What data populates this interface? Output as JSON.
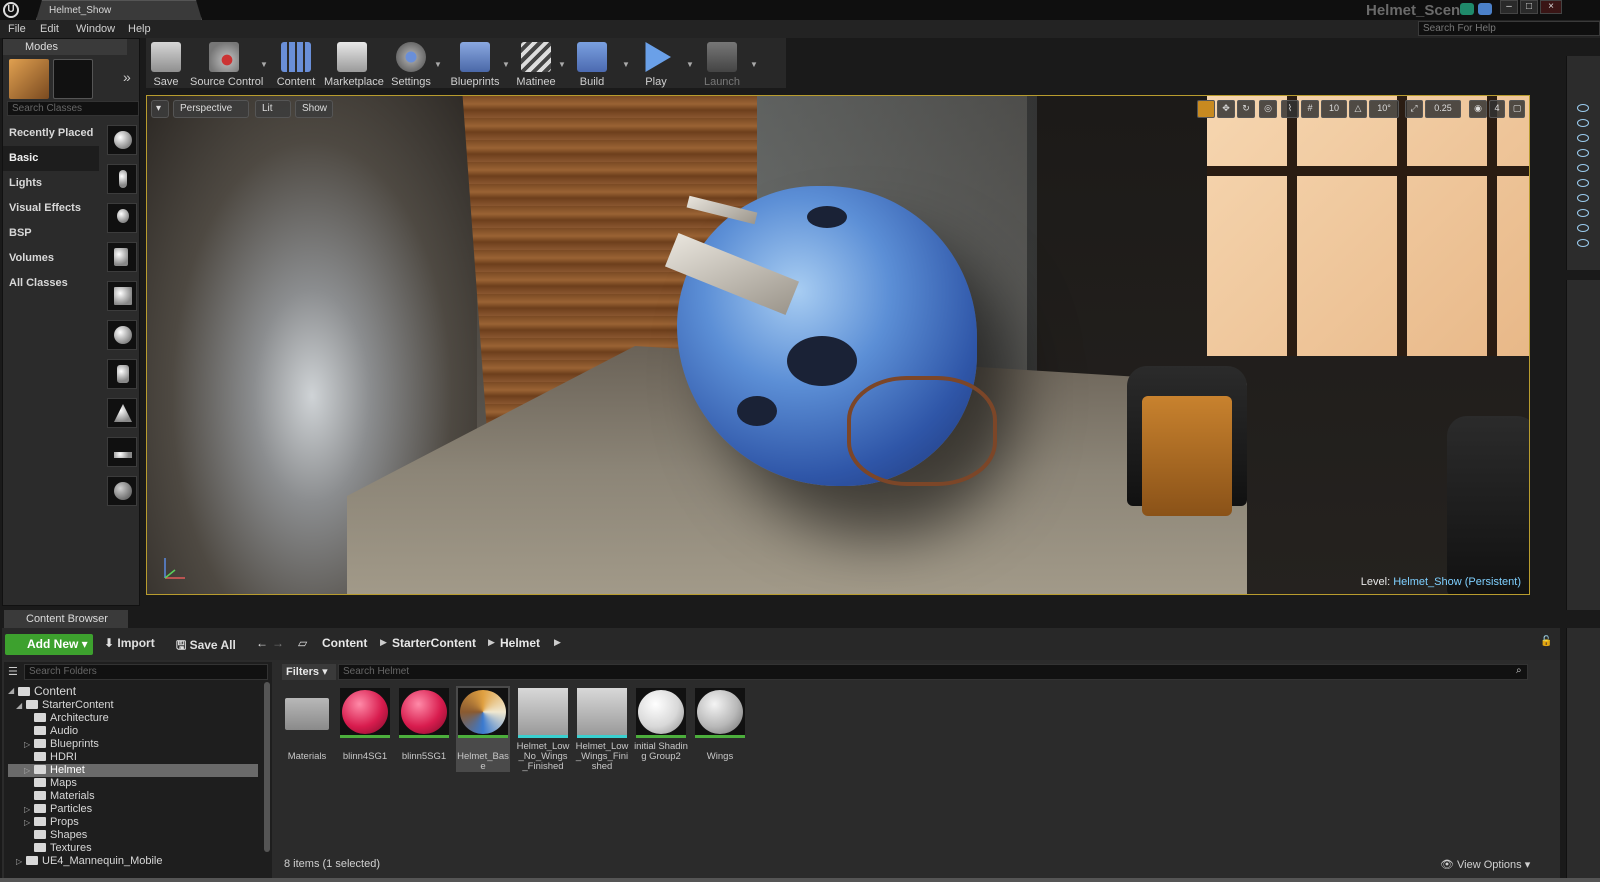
{
  "window": {
    "tab_title": "Helmet_Show",
    "scene_title": "Helmet_Scene",
    "help_search_placeholder": "Search For Help"
  },
  "menu": [
    "File",
    "Edit",
    "Window",
    "Help"
  ],
  "modes": {
    "tab_label": "Modes",
    "search_placeholder": "Search Classes",
    "categories": [
      "Recently Placed",
      "Basic",
      "Lights",
      "Visual Effects",
      "BSP",
      "Volumes",
      "All Classes"
    ],
    "active_category": "Basic"
  },
  "toolbar": {
    "buttons": [
      {
        "label": "Save",
        "icon": "save-icon"
      },
      {
        "label": "Source Control",
        "icon": "source-control-icon"
      },
      {
        "label": "Content",
        "icon": "content-icon"
      },
      {
        "label": "Marketplace",
        "icon": "marketplace-icon"
      },
      {
        "label": "Settings",
        "icon": "settings-icon"
      },
      {
        "label": "Blueprints",
        "icon": "blueprints-icon"
      },
      {
        "label": "Matinee",
        "icon": "matinee-icon"
      },
      {
        "label": "Build",
        "icon": "build-icon"
      },
      {
        "label": "Play",
        "icon": "play-icon"
      },
      {
        "label": "Launch",
        "icon": "launch-icon"
      }
    ]
  },
  "viewport": {
    "perspective_label": "Perspective",
    "lit_label": "Lit",
    "show_label": "Show",
    "grid_snap": "10",
    "rotation_snap": "10°",
    "scale_snap": "0.25",
    "camera_speed": "4",
    "level_label": "Level:",
    "level_name": "Helmet_Show (Persistent)"
  },
  "content_browser": {
    "tab_label": "Content Browser",
    "add_new_label": "Add New",
    "import_label": "Import",
    "save_all_label": "Save All",
    "breadcrumb": [
      "Content",
      "StarterContent",
      "Helmet"
    ],
    "search_folders_placeholder": "Search Folders",
    "filters_label": "Filters",
    "search_assets_placeholder": "Search Helmet",
    "tree": [
      {
        "label": "Content",
        "level": 0,
        "expanded": true
      },
      {
        "label": "StarterContent",
        "level": 1,
        "expanded": true
      },
      {
        "label": "Architecture",
        "level": 2
      },
      {
        "label": "Audio",
        "level": 2
      },
      {
        "label": "Blueprints",
        "level": 2,
        "has_children": true
      },
      {
        "label": "HDRI",
        "level": 2
      },
      {
        "label": "Helmet",
        "level": 2,
        "has_children": true,
        "selected": true
      },
      {
        "label": "Maps",
        "level": 2
      },
      {
        "label": "Materials",
        "level": 2
      },
      {
        "label": "Particles",
        "level": 2,
        "has_children": true
      },
      {
        "label": "Props",
        "level": 2,
        "has_children": true
      },
      {
        "label": "Shapes",
        "level": 2
      },
      {
        "label": "Textures",
        "level": 2
      },
      {
        "label": "UE4_Mannequin_Mobile",
        "level": 1,
        "has_children": true
      }
    ],
    "assets": [
      {
        "label": "Materials",
        "kind": "folder"
      },
      {
        "label": "blinn4SG1",
        "kind": "material",
        "color": "#d81c4e"
      },
      {
        "label": "blinn5SG1",
        "kind": "material",
        "color": "#d81c4e"
      },
      {
        "label": "Helmet_Base",
        "kind": "material",
        "selected": true
      },
      {
        "label": "Helmet_Low_No_Wings_Finished",
        "kind": "mesh"
      },
      {
        "label": "Helmet_Low_Wings_Finished",
        "kind": "mesh"
      },
      {
        "label": "initial Shading Group2",
        "kind": "material",
        "color": "#e8e8e8"
      },
      {
        "label": "Wings",
        "kind": "material",
        "color": "#c8c8c8"
      }
    ],
    "item_count": "8 items (1 selected)",
    "view_options_label": "View Options"
  },
  "colors": {
    "accent_green": "#3da12e",
    "viewport_border": "#b89c2e",
    "level_text": "#7fd0ff"
  }
}
